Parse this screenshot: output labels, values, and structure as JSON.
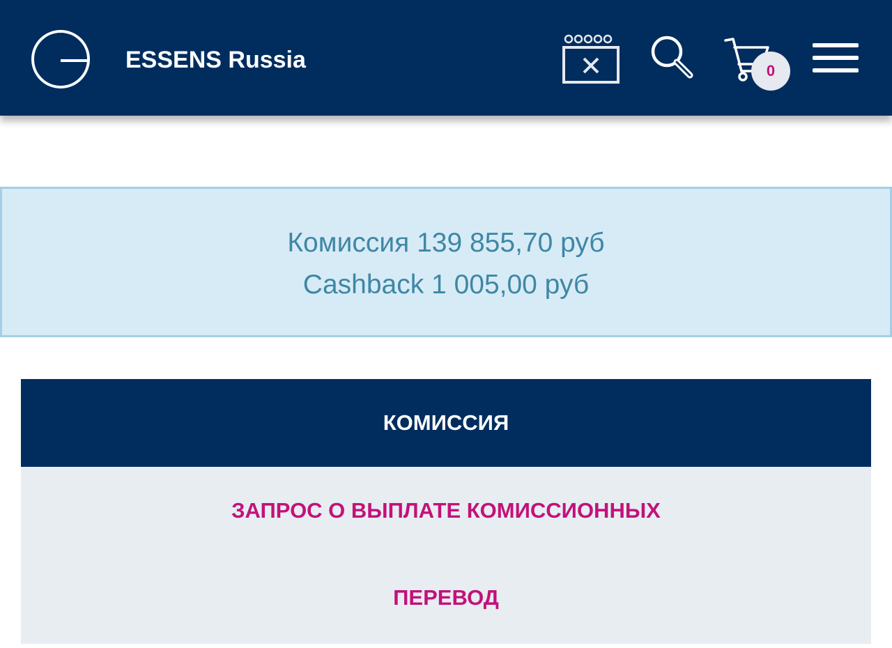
{
  "header": {
    "brand": "ESSENS Russia",
    "cart_count": "0",
    "icons": {
      "logo": "essens-logo-icon",
      "popup": "close-window-icon",
      "search": "search-icon",
      "cart": "cart-icon",
      "menu": "hamburger-menu-icon"
    }
  },
  "balance": {
    "commission": "Комиссия 139 855,70 руб",
    "cashback": "Cashback 1 005,00 руб"
  },
  "panel": {
    "title": "КОМИССИЯ",
    "links": [
      "ЗАПРОС О ВЫПЛАТЕ КОМИССИОННЫХ",
      "ПЕРЕВОД"
    ]
  },
  "colors": {
    "navy": "#002d5e",
    "balance_bg": "#d7ebf6",
    "balance_text": "#3f87a5",
    "link": "#c2127a",
    "panel_bg": "#e8edf2"
  }
}
